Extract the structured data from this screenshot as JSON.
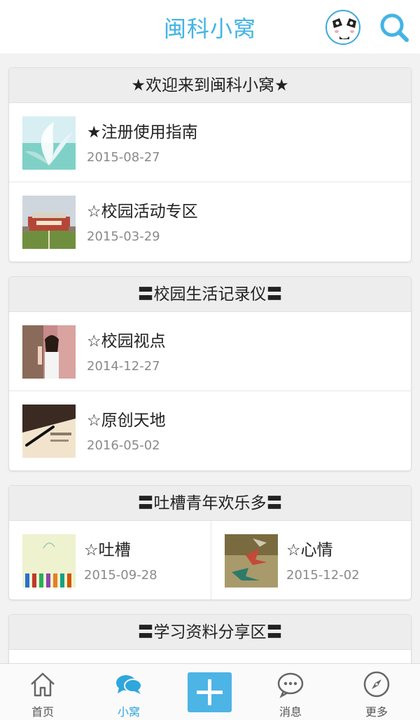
{
  "header": {
    "title": "闽科小窝",
    "avatar_icon": "panda-avatar-icon",
    "search_icon": "search-icon",
    "accent": "#44b4e4"
  },
  "sections": [
    {
      "heading": "★欢迎来到闽科小窝★",
      "items": [
        {
          "title": "★注册使用指南",
          "date": "2015-08-27",
          "thumb": "flower-thumbnail"
        },
        {
          "title": "☆校园活动专区",
          "date": "2015-03-29",
          "thumb": "campus-building-thumbnail"
        }
      ]
    },
    {
      "heading": "〓校园生活记录仪〓",
      "items": [
        {
          "title": "☆校园视点",
          "date": "2014-12-27",
          "thumb": "girl-tree-thumbnail"
        },
        {
          "title": "☆原创天地",
          "date": "2016-05-02",
          "thumb": "pen-paper-thumbnail"
        }
      ]
    },
    {
      "heading": "〓吐槽青年欢乐多〓",
      "items": [
        {
          "title": "☆吐槽",
          "date": "2015-09-28",
          "thumb": "colored-pencils-thumbnail"
        },
        {
          "title": "☆心情",
          "date": "2015-12-02",
          "thumb": "paper-cranes-thumbnail"
        }
      ]
    },
    {
      "heading": "〓学习资料分享区〓",
      "items": []
    }
  ],
  "tabbar": {
    "tabs": [
      {
        "label": "首页",
        "icon": "home-icon"
      },
      {
        "label": "小窝",
        "icon": "chat-bubbles-icon"
      },
      {
        "label": "",
        "icon": "plus-icon"
      },
      {
        "label": "消息",
        "icon": "message-icon"
      },
      {
        "label": "更多",
        "icon": "compass-icon"
      }
    ],
    "active_color": "#2ea7dd"
  }
}
